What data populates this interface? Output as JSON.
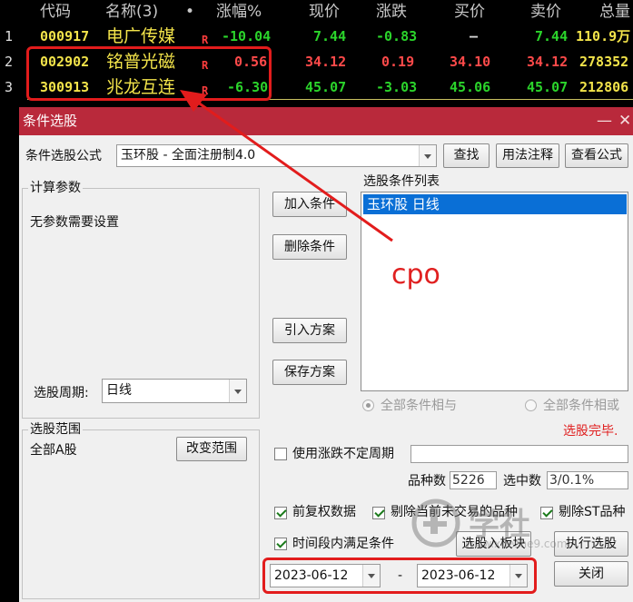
{
  "table": {
    "headers": [
      "代码",
      "名称(3)",
      "•",
      "涨幅%",
      "现价",
      "涨跌",
      "买价",
      "卖价",
      "总量"
    ],
    "rows": [
      {
        "idx": "1",
        "code": "000917",
        "name": "电广传媒",
        "flag": "R",
        "pct": "-10.04",
        "price": "7.44",
        "chg": "-0.83",
        "bid": "–",
        "ask": "7.44",
        "vol": "110.9万"
      },
      {
        "idx": "2",
        "code": "002902",
        "name": "铭普光磁",
        "flag": "R",
        "pct": "0.56",
        "price": "34.12",
        "chg": "0.19",
        "bid": "34.10",
        "ask": "34.12",
        "vol": "278352"
      },
      {
        "idx": "3",
        "code": "300913",
        "name": "兆龙互连",
        "flag": "R",
        "pct": "-6.30",
        "price": "45.07",
        "chg": "-3.03",
        "bid": "45.06",
        "ask": "45.07",
        "vol": "212806"
      }
    ]
  },
  "dialog": {
    "title": "条件选股",
    "min_glyph": "—",
    "close_glyph": "✕",
    "formula_label": "条件选股公式",
    "formula_value": "玉环股      - 全面注册制4.0",
    "btn_find": "查找",
    "btn_usage": "用法注释",
    "btn_view": "查看公式",
    "params_group": "计算参数",
    "params_text": "无参数需要设置",
    "btn_add": "加入条件",
    "btn_delete": "删除条件",
    "btn_import": "引入方案",
    "btn_save": "保存方案",
    "list_label": "选股条件列表",
    "list_items": [
      "玉环股  日线"
    ],
    "period_label": "选股周期:",
    "period_value": "日线",
    "radio_and": "全部条件相与",
    "radio_or": "全部条件相或",
    "status_text": "选股完毕.",
    "range_group": "选股范围",
    "range_value": "全部A股",
    "btn_change_range": "改变范围",
    "chk_variable_period": "使用涨跌不定周期",
    "variety_label": "品种数",
    "variety_value": "5226",
    "selected_label": "选中数",
    "selected_value": "3/0.1%",
    "chk_adjust": "前复权数据",
    "chk_exclude_untraded": "剔除当前未交易的品种",
    "chk_exclude_st": "剔除ST品种",
    "chk_time_period": "时间段内满足条件",
    "btn_to_block": "选股入板块",
    "btn_execute": "执行选股",
    "date_start": "2023-06-12",
    "date_sep": "-",
    "date_end": "2023-06-12",
    "btn_close": "关闭"
  },
  "annotation": {
    "text": "cpo",
    "color": "#e21c1c"
  },
  "watermark": {
    "brand": "学社",
    "url": "www.xueshe9.com"
  },
  "colors": {
    "up": "#ff4a4a",
    "down": "#2bd42b",
    "code": "#f2e34a",
    "titlebar": "#b9293b",
    "selection": "#0a6fd6"
  }
}
